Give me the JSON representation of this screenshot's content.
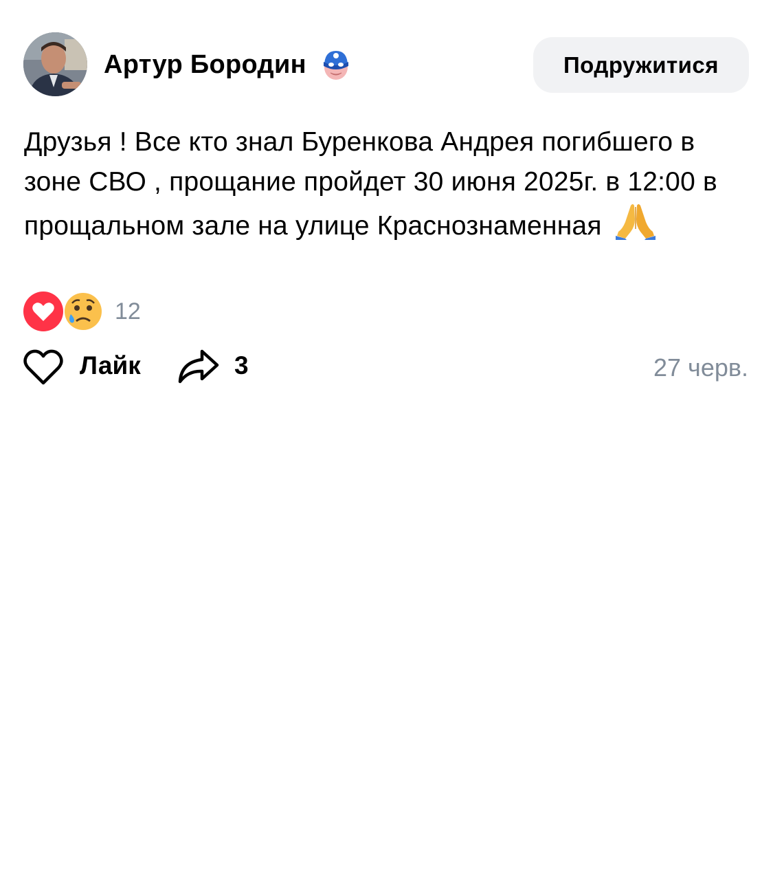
{
  "post": {
    "author": {
      "name": "Артур Бородин",
      "avatar_icon": "user-photo",
      "badge_icon": "masked-hero-emoji"
    },
    "add_friend_label": "Подружитися",
    "text": "Друзья ! Все кто знал Буренкова Андрея погибшего в зоне СВО , прощание пройдет 30 июня 2025г. в 12:00 в прощальном зале на улице Красноз­наменная",
    "text_emoji": "pray-hands-emoji",
    "reactions": {
      "icons": [
        "heart-reaction",
        "sad-tear-reaction"
      ],
      "count": "12"
    },
    "actions": {
      "like_label": "Лайк",
      "share_count": "3"
    },
    "date": "27 черв."
  },
  "colors": {
    "button_bg": "#f1f2f4",
    "secondary_text": "#818c99",
    "heart_red": "#ff3347"
  }
}
